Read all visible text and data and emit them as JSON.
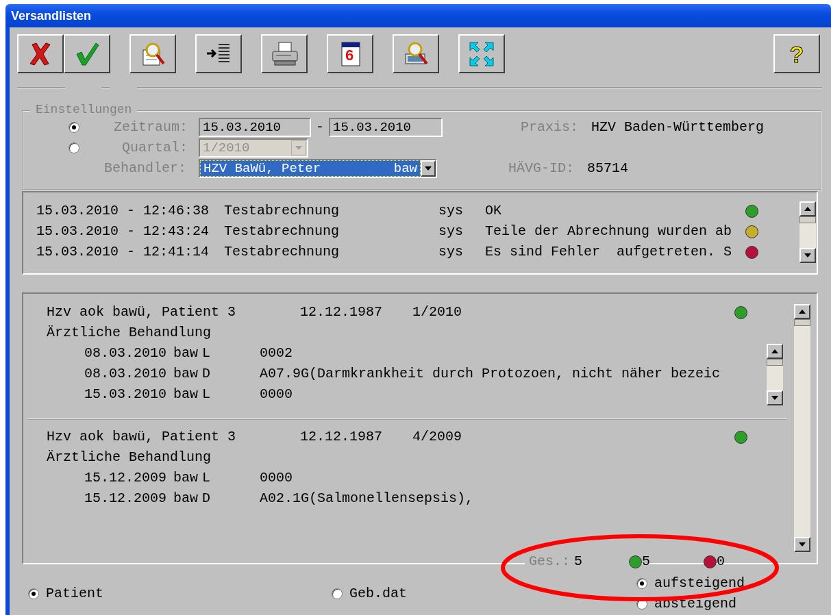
{
  "window": {
    "title": "Versandlisten"
  },
  "toolbar": [
    {
      "kind": "cancel"
    },
    {
      "kind": "confirm"
    },
    {
      "kind": "search-document"
    },
    {
      "kind": "indent"
    },
    {
      "kind": "print"
    },
    {
      "kind": "calendar",
      "label": "6"
    },
    {
      "kind": "search-computer"
    },
    {
      "kind": "expand"
    },
    {
      "kind": "help",
      "label": "?"
    }
  ],
  "settings": {
    "legend": "Einstellungen",
    "modes": [
      {
        "label": "Zeitraum:",
        "selected": true
      },
      {
        "label": "Quartal:",
        "selected": false
      }
    ],
    "date_from": "15.03.2010",
    "date_separator": "-",
    "date_to": "15.03.2010",
    "quarter": {
      "value": "1/2010",
      "disabled": true
    },
    "behandler": {
      "label": "Behandler:",
      "name": "HZV BaWü, Peter",
      "code": "baw"
    },
    "praxis": {
      "label": "Praxis:",
      "value": "HZV Baden-Württemberg"
    },
    "haevg_id": {
      "label": "HÄVG-ID:",
      "value": "85714"
    }
  },
  "log": [
    {
      "date_time": "15.03.2010 - 12:46:38",
      "type": "Testabrechnung",
      "user": "sys",
      "message": "OK",
      "color": "#2e9e2a"
    },
    {
      "date_time": "15.03.2010 - 12:43:24",
      "type": "Testabrechnung",
      "user": "sys",
      "message": "Teile der Abrechnung wurden ab",
      "color": "#c4ae2c"
    },
    {
      "date_time": "15.03.2010 - 12:41:14",
      "type": "Testabrechnung",
      "user": "sys",
      "message": "Es sind Fehler  aufgetreten. S",
      "color": "#b8103c"
    }
  ],
  "records": [
    {
      "patient": "Hzv aok bawü, Patient 3",
      "birth_date": "12.12.1987",
      "quarter": "1/2010",
      "color": "#2e9e2a",
      "section": "Ärztliche Behandlung",
      "scrollable": true,
      "entries": [
        {
          "date": "08.03.2010",
          "code": "baw",
          "kind": "L",
          "value": "0002"
        },
        {
          "date": "08.03.2010",
          "code": "baw",
          "kind": "D",
          "value": "A07.9G(Darmkrankheit durch Protozoen, nicht näher bezeic"
        },
        {
          "date": "15.03.2010",
          "code": "baw",
          "kind": "L",
          "value": "0000"
        }
      ]
    },
    {
      "patient": "Hzv aok bawü, Patient 3",
      "birth_date": "12.12.1987",
      "quarter": "4/2009",
      "color": "#2e9e2a",
      "section": "Ärztliche Behandlung",
      "scrollable": false,
      "entries": [
        {
          "date": "15.12.2009",
          "code": "baw",
          "kind": "L",
          "value": "0000"
        },
        {
          "date": "15.12.2009",
          "code": "baw",
          "kind": "D",
          "value": "A02.1G(Salmonellensepsis),"
        }
      ]
    }
  ],
  "summary": {
    "label": "Ges.:",
    "total": "5",
    "counts": [
      {
        "value": "5",
        "color": "#2e9e2a"
      },
      {
        "value": "0",
        "color": "#b8103c"
      }
    ]
  },
  "sort_by": [
    {
      "label": "Patient",
      "selected": true
    },
    {
      "label": "Geb.dat",
      "selected": false
    }
  ],
  "order": [
    {
      "label": "aufsteigend",
      "selected": true
    },
    {
      "label": "absteigend",
      "selected": false
    }
  ]
}
